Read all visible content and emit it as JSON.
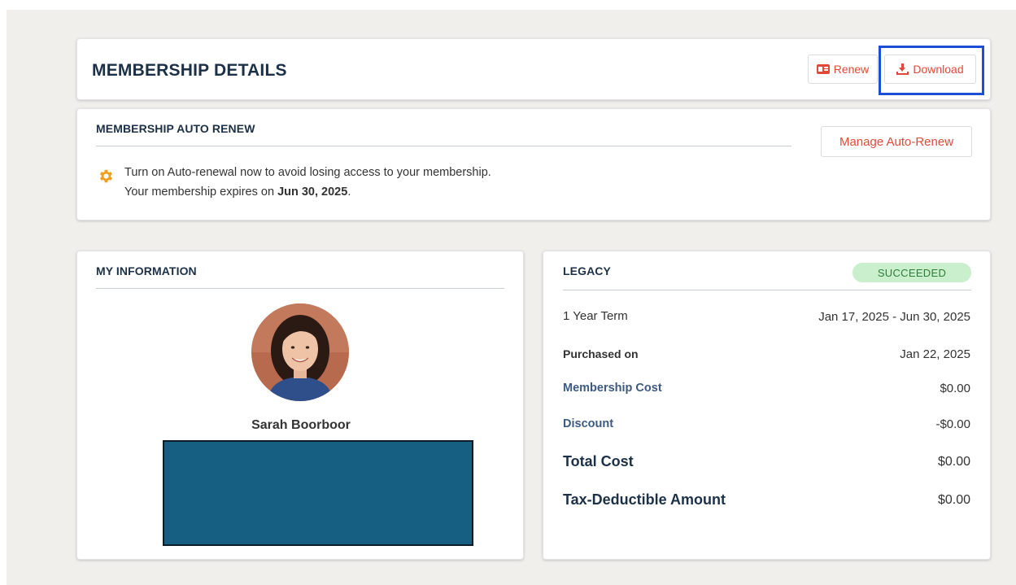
{
  "header": {
    "title": "MEMBERSHIP DETAILS",
    "renew_label": "Renew",
    "download_label": "Download"
  },
  "auto_renew": {
    "title": "MEMBERSHIP AUTO RENEW",
    "manage_label": "Manage Auto-Renew",
    "notice_line1": "Turn on Auto-renewal now to avoid losing access to your membership.",
    "notice_line2_prefix": "Your membership expires on ",
    "expiry_date": "Jun 30, 2025",
    "notice_line2_suffix": ".",
    "icon": "gear-icon"
  },
  "my_information": {
    "title": "MY INFORMATION",
    "name": "Sarah Boorboor"
  },
  "legacy": {
    "title": "LEGACY",
    "status": "SUCCEEDED",
    "term_label": "1 Year Term",
    "term_value": "Jan 17, 2025 - Jun 30, 2025",
    "purchased_label": "Purchased on",
    "purchased_value": "Jan 22, 2025",
    "cost_label": "Membership Cost",
    "cost_value": "$0.00",
    "discount_label": "Discount",
    "discount_value": "-$0.00",
    "total_label": "Total Cost",
    "total_value": "$0.00",
    "tax_label": "Tax-Deductible Amount",
    "tax_value": "$0.00"
  },
  "colors": {
    "accent": "#e04a3a",
    "heading": "#1c3147",
    "link_label": "#3d5a82",
    "status_bg": "#c9efcd",
    "status_text": "#2f7d3a",
    "focus": "#1f4ed6",
    "redacted": "#175f82"
  }
}
